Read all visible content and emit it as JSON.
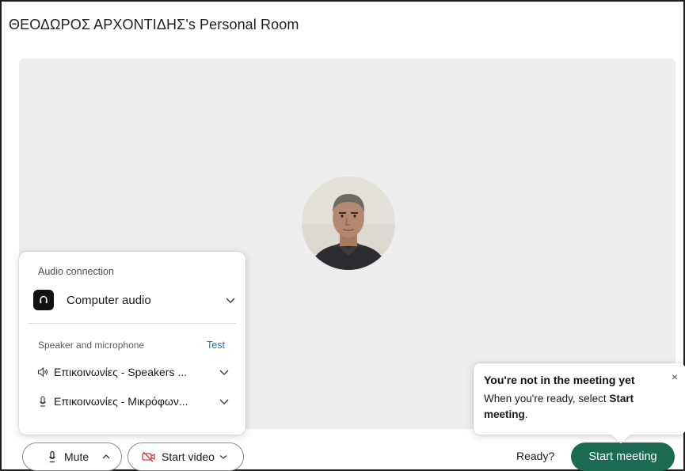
{
  "room": {
    "title": "ΘΕΟΔΩΡΟΣ ΑΡΧΟΝΤΙΔΗΣ's Personal Room"
  },
  "avatar": {
    "icon": "user-photo"
  },
  "audio_panel": {
    "heading": "Audio connection",
    "connection_type": "Computer audio",
    "section_label": "Speaker and microphone",
    "test_label": "Test",
    "speaker_device": "Επικοινωνίες - Speakers ...",
    "microphone_device": "Επικοινωνίες - Μικρόφων..."
  },
  "toolbar": {
    "mute_label": "Mute",
    "video_label": "Start video",
    "ready_label": "Ready?",
    "start_label": "Start meeting"
  },
  "tooltip": {
    "title": "You're not in the meeting yet",
    "body_prefix": "When you're ready, select ",
    "body_bold": "Start meeting",
    "body_suffix": ".",
    "close_glyph": "×"
  },
  "colors": {
    "start_button": "#1b6b53",
    "link": "#1d6fb8",
    "stage_bg": "#ededed"
  }
}
